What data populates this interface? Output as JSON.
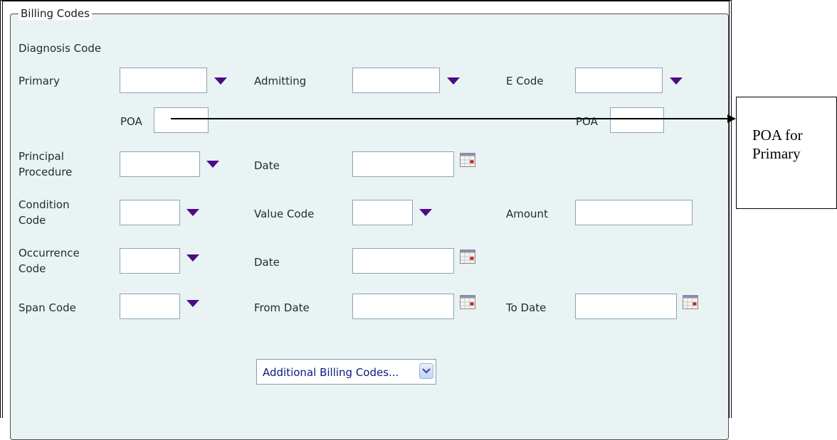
{
  "section": {
    "legend": "Billing Codes",
    "subtitle": "Diagnosis Code"
  },
  "labels": {
    "primary": "Primary",
    "admitting": "Admitting",
    "e_code": "E Code",
    "poa_primary": "POA",
    "poa_ecode": "POA",
    "principal_procedure": "Principal\nProcedure",
    "proc_date": "Date",
    "condition_code": "Condition\nCode",
    "value_code": "Value Code",
    "amount": "Amount",
    "occurrence_code": "Occurrence\nCode",
    "occ_date": "Date",
    "span_code": "Span Code",
    "from_date": "From Date",
    "to_date": "To Date"
  },
  "dropdown": {
    "selected": "Additional Billing Codes..."
  },
  "callout": {
    "text": "POA for\nPrimary"
  },
  "icons": {
    "dropdown_triangle": "down-triangle-icon",
    "calendar": "calendar-icon",
    "chevron": "chevron-down-icon"
  },
  "colors": {
    "panel": "#e9f3f3",
    "triangle": "#4b0a86",
    "label": "#1e2a33",
    "input_border": "#8aa3b8"
  }
}
